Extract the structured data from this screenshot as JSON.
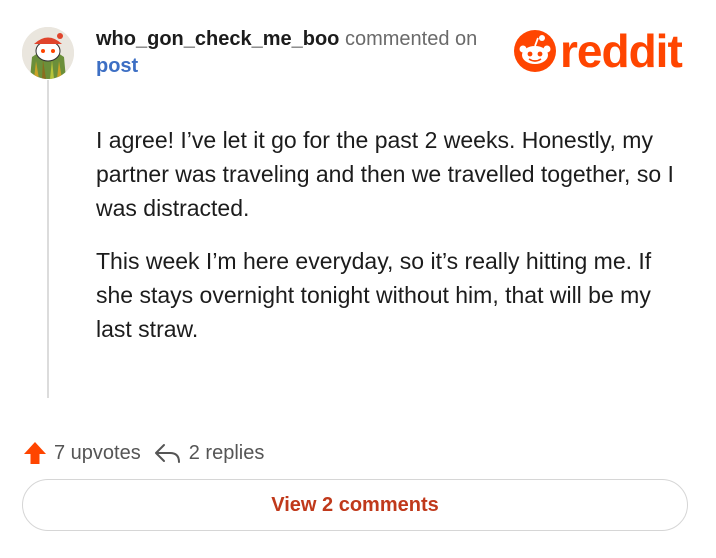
{
  "comment": {
    "username": "who_gon_check_me_boo",
    "action_text": "commented on",
    "target_link": "post",
    "paragraphs": [
      "I agree! I’ve let it go for the past 2 weeks. Honestly, my partner was traveling and then we travelled together, so I was distracted.",
      "This week I’m here everyday, so it’s really hitting me. If she stays overnight tonight without him, that will be my last straw."
    ]
  },
  "branding": {
    "logo_text": "reddit",
    "logo_icon": "reddit-alien-icon",
    "brand_color": "#ff4500"
  },
  "actions": {
    "upvote_icon": "upvote-arrow-icon",
    "upvotes_label": "7 upvotes",
    "reply_icon": "reply-arrow-icon",
    "replies_label": "2 replies"
  },
  "footer": {
    "view_button_label": "View 2 comments",
    "button_text_color": "#c0391b"
  },
  "colors": {
    "link": "#3d6fc4",
    "upvote": "#ff4500",
    "muted": "#6a6a6a"
  }
}
